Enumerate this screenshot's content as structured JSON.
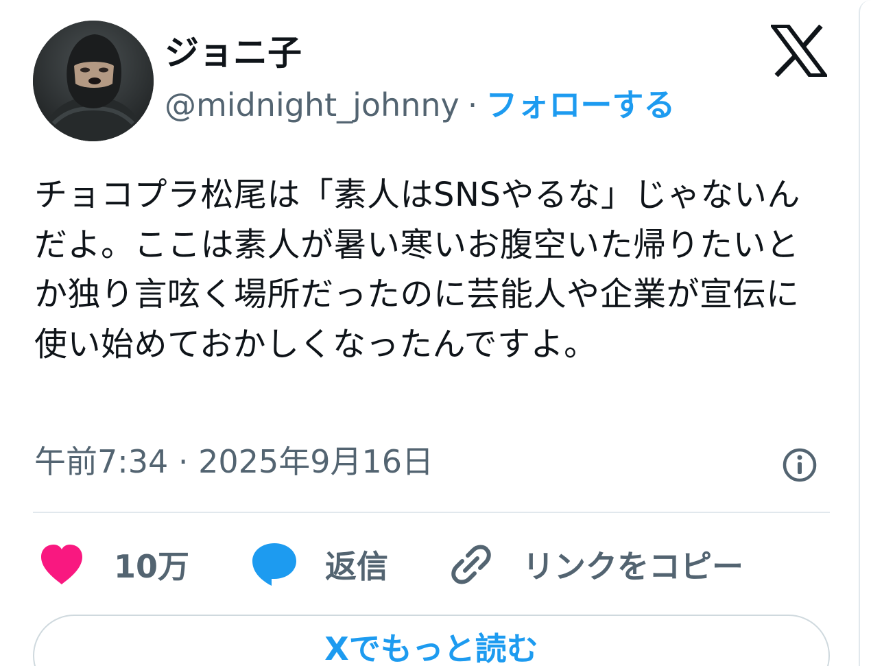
{
  "author": {
    "display_name": "ジョニ子",
    "handle": "@midnight_johnny",
    "separator": "·",
    "follow_label": "フォローする"
  },
  "tweet": {
    "text": "チョコプラ松尾は「素人はSNSやるな」じゃないんだよ。ここは素人が暑い寒いお腹空いた帰りたいとか独り言呟く場所だったのに芸能人や企業が宣伝に使い始めておかしくなったんですよ。",
    "timestamp": "午前7:34 · 2025年9月16日"
  },
  "actions": {
    "like_count": "10万",
    "reply_label": "返信",
    "copy_link_label": "リンクをコピー"
  },
  "footer": {
    "read_more_label": "Xでもっと読む"
  },
  "colors": {
    "accent": "#1d9bf0",
    "like": "#f91880",
    "muted": "#536471",
    "text": "#0f1419"
  },
  "icons": {
    "brand": "x-logo-icon",
    "info": "info-icon",
    "like": "heart-icon",
    "reply": "speech-bubble-icon",
    "copy": "link-icon"
  }
}
